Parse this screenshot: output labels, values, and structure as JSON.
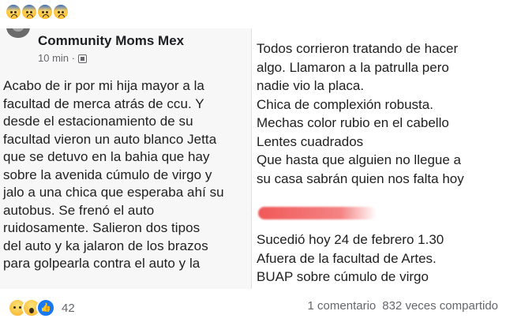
{
  "top_reactions": {
    "icons": [
      "anxious-face-icon",
      "anxious-face-icon",
      "anxious-face-icon",
      "anxious-face-icon"
    ]
  },
  "post": {
    "group_name": "Community Moms Mex",
    "time": "10 min ·",
    "left_lines": [
      "Acabo de ir por mi hija mayor a la",
      "facultad de merca atrás de ccu. Y",
      "desde el estacionamiento de su",
      "facultad vieron un auto blanco Jetta",
      "que se detuvo en la bahia que hay",
      "sobre la avenida cúmulo de virgo y",
      "jalo a una chica que esperaba ahí su",
      "autobus. Se frenó el auto",
      "ruidosamente. Salieron dos tipos",
      "del auto y ka jalaron de los brazos",
      "para golpearla contra el auto y la"
    ],
    "right_lines": [
      "Todos corrieron tratando de hacer",
      "algo. Llamaron a la patrulla pero",
      "nadie vio la placa.",
      "Chica de complexión robusta.",
      "Mechas color rubio en el cabello",
      "Lentes cuadrados",
      "Que hasta que alguien no llegue a",
      "su casa sabrán quien nos falta hoy"
    ],
    "right_lines_2": [
      "Sucedió hoy 24 de febrero  1.30",
      "Afuera de la facultad de Artes.",
      "BUAP sobre cúmulo de virgo"
    ]
  },
  "footer": {
    "reaction_icons": [
      "sad-icon",
      "wow-icon",
      "like-icon"
    ],
    "reaction_count": "42",
    "comments": "1 comentario",
    "shares": "832 veces compartido"
  },
  "colors": {
    "accent": "#1877f2",
    "muted": "#65676b",
    "redaction": "#f05050"
  }
}
